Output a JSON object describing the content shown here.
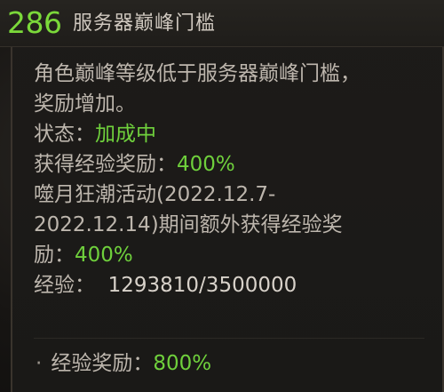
{
  "header": {
    "level": "286",
    "title": "服务器巅峰门槛"
  },
  "description": {
    "line1": "角色巅峰等级低于服务器巅峰门槛，",
    "line2": "奖励增加。"
  },
  "status": {
    "label": "状态：",
    "value": "加成中"
  },
  "exp_reward": {
    "label": "获得经验奖励：",
    "value": "400%"
  },
  "event": {
    "line1": "噬月狂潮活动(2022.12.7-",
    "line2": "2022.12.14)期间额外获得经验奖",
    "line3_label": "励：",
    "line3_value": "400%"
  },
  "experience": {
    "label": "经验：",
    "value": "1293810/3500000"
  },
  "total_bonus": {
    "bullet": "·",
    "label": "经验奖励：",
    "value": "800%"
  },
  "colors": {
    "level_green": "#7bd93a",
    "value_green": "#6fd03c",
    "text": "#bdb6ad"
  }
}
